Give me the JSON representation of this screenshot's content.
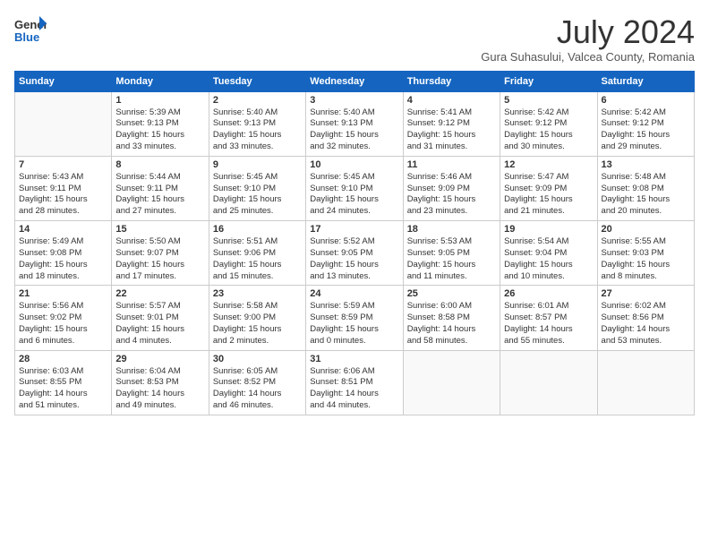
{
  "header": {
    "logo_general": "General",
    "logo_blue": "Blue",
    "month_title": "July 2024",
    "subtitle": "Gura Suhasului, Valcea County, Romania"
  },
  "days_of_week": [
    "Sunday",
    "Monday",
    "Tuesday",
    "Wednesday",
    "Thursday",
    "Friday",
    "Saturday"
  ],
  "weeks": [
    [
      {
        "day": "",
        "info": ""
      },
      {
        "day": "1",
        "info": "Sunrise: 5:39 AM\nSunset: 9:13 PM\nDaylight: 15 hours\nand 33 minutes."
      },
      {
        "day": "2",
        "info": "Sunrise: 5:40 AM\nSunset: 9:13 PM\nDaylight: 15 hours\nand 33 minutes."
      },
      {
        "day": "3",
        "info": "Sunrise: 5:40 AM\nSunset: 9:13 PM\nDaylight: 15 hours\nand 32 minutes."
      },
      {
        "day": "4",
        "info": "Sunrise: 5:41 AM\nSunset: 9:12 PM\nDaylight: 15 hours\nand 31 minutes."
      },
      {
        "day": "5",
        "info": "Sunrise: 5:42 AM\nSunset: 9:12 PM\nDaylight: 15 hours\nand 30 minutes."
      },
      {
        "day": "6",
        "info": "Sunrise: 5:42 AM\nSunset: 9:12 PM\nDaylight: 15 hours\nand 29 minutes."
      }
    ],
    [
      {
        "day": "7",
        "info": "Sunrise: 5:43 AM\nSunset: 9:11 PM\nDaylight: 15 hours\nand 28 minutes."
      },
      {
        "day": "8",
        "info": "Sunrise: 5:44 AM\nSunset: 9:11 PM\nDaylight: 15 hours\nand 27 minutes."
      },
      {
        "day": "9",
        "info": "Sunrise: 5:45 AM\nSunset: 9:10 PM\nDaylight: 15 hours\nand 25 minutes."
      },
      {
        "day": "10",
        "info": "Sunrise: 5:45 AM\nSunset: 9:10 PM\nDaylight: 15 hours\nand 24 minutes."
      },
      {
        "day": "11",
        "info": "Sunrise: 5:46 AM\nSunset: 9:09 PM\nDaylight: 15 hours\nand 23 minutes."
      },
      {
        "day": "12",
        "info": "Sunrise: 5:47 AM\nSunset: 9:09 PM\nDaylight: 15 hours\nand 21 minutes."
      },
      {
        "day": "13",
        "info": "Sunrise: 5:48 AM\nSunset: 9:08 PM\nDaylight: 15 hours\nand 20 minutes."
      }
    ],
    [
      {
        "day": "14",
        "info": "Sunrise: 5:49 AM\nSunset: 9:08 PM\nDaylight: 15 hours\nand 18 minutes."
      },
      {
        "day": "15",
        "info": "Sunrise: 5:50 AM\nSunset: 9:07 PM\nDaylight: 15 hours\nand 17 minutes."
      },
      {
        "day": "16",
        "info": "Sunrise: 5:51 AM\nSunset: 9:06 PM\nDaylight: 15 hours\nand 15 minutes."
      },
      {
        "day": "17",
        "info": "Sunrise: 5:52 AM\nSunset: 9:05 PM\nDaylight: 15 hours\nand 13 minutes."
      },
      {
        "day": "18",
        "info": "Sunrise: 5:53 AM\nSunset: 9:05 PM\nDaylight: 15 hours\nand 11 minutes."
      },
      {
        "day": "19",
        "info": "Sunrise: 5:54 AM\nSunset: 9:04 PM\nDaylight: 15 hours\nand 10 minutes."
      },
      {
        "day": "20",
        "info": "Sunrise: 5:55 AM\nSunset: 9:03 PM\nDaylight: 15 hours\nand 8 minutes."
      }
    ],
    [
      {
        "day": "21",
        "info": "Sunrise: 5:56 AM\nSunset: 9:02 PM\nDaylight: 15 hours\nand 6 minutes."
      },
      {
        "day": "22",
        "info": "Sunrise: 5:57 AM\nSunset: 9:01 PM\nDaylight: 15 hours\nand 4 minutes."
      },
      {
        "day": "23",
        "info": "Sunrise: 5:58 AM\nSunset: 9:00 PM\nDaylight: 15 hours\nand 2 minutes."
      },
      {
        "day": "24",
        "info": "Sunrise: 5:59 AM\nSunset: 8:59 PM\nDaylight: 15 hours\nand 0 minutes."
      },
      {
        "day": "25",
        "info": "Sunrise: 6:00 AM\nSunset: 8:58 PM\nDaylight: 14 hours\nand 58 minutes."
      },
      {
        "day": "26",
        "info": "Sunrise: 6:01 AM\nSunset: 8:57 PM\nDaylight: 14 hours\nand 55 minutes."
      },
      {
        "day": "27",
        "info": "Sunrise: 6:02 AM\nSunset: 8:56 PM\nDaylight: 14 hours\nand 53 minutes."
      }
    ],
    [
      {
        "day": "28",
        "info": "Sunrise: 6:03 AM\nSunset: 8:55 PM\nDaylight: 14 hours\nand 51 minutes."
      },
      {
        "day": "29",
        "info": "Sunrise: 6:04 AM\nSunset: 8:53 PM\nDaylight: 14 hours\nand 49 minutes."
      },
      {
        "day": "30",
        "info": "Sunrise: 6:05 AM\nSunset: 8:52 PM\nDaylight: 14 hours\nand 46 minutes."
      },
      {
        "day": "31",
        "info": "Sunrise: 6:06 AM\nSunset: 8:51 PM\nDaylight: 14 hours\nand 44 minutes."
      },
      {
        "day": "",
        "info": ""
      },
      {
        "day": "",
        "info": ""
      },
      {
        "day": "",
        "info": ""
      }
    ]
  ]
}
